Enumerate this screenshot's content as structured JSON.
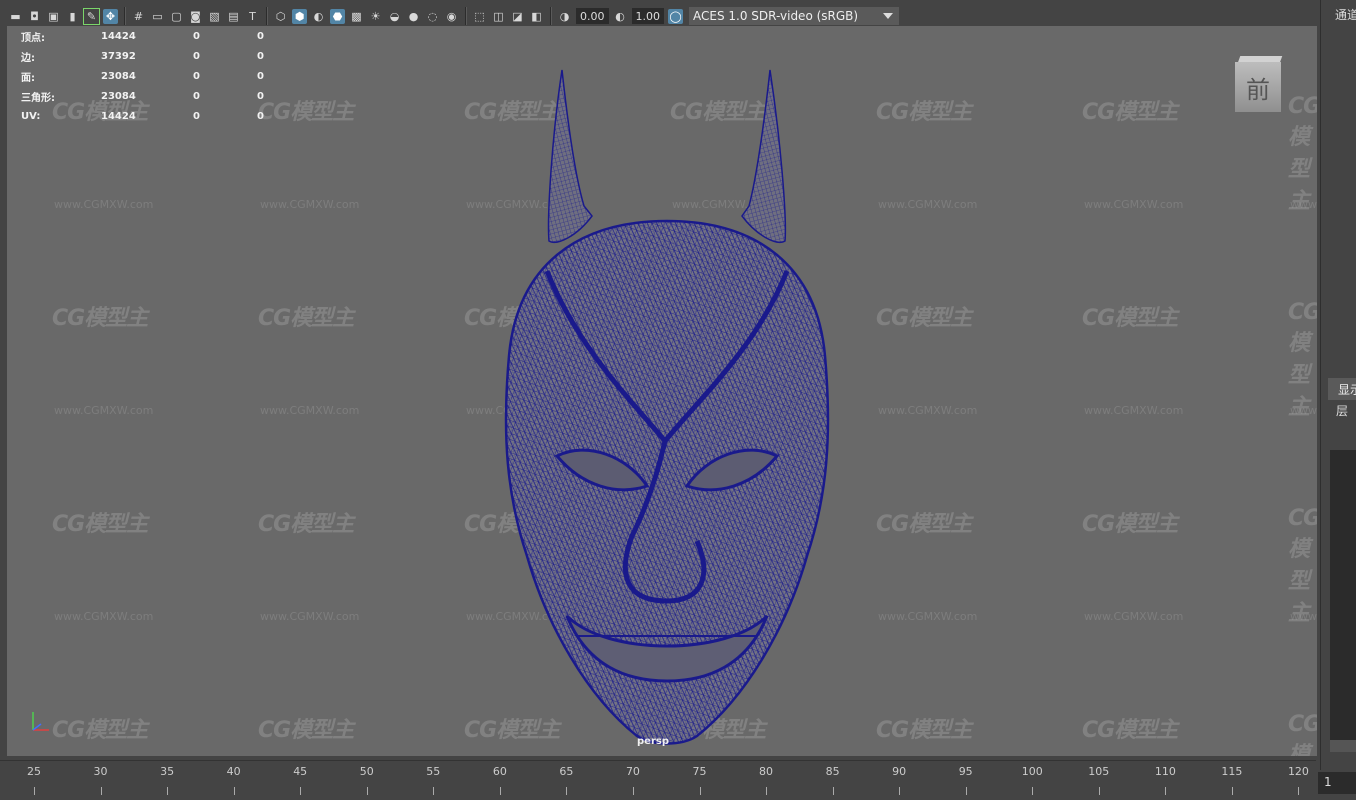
{
  "toolbar": {
    "gamma_value": "0.00",
    "exposure_value": "1.00",
    "color_management": "ACES 1.0 SDR-video (sRGB)",
    "icons": [
      "camera-select-icon",
      "camera-attributes-icon",
      "bookmarks-icon",
      "image-plane-icon",
      "grease-pencil-icon",
      "2d-pan-zoom-icon",
      "grid-icon",
      "film-gate-icon",
      "resolution-gate-icon",
      "gate-mask-icon",
      "field-chart-icon",
      "safe-action-icon",
      "safe-title-icon",
      "wireframe-icon",
      "smooth-shade-icon",
      "default-material-icon",
      "wireframe-on-shaded-icon",
      "textured-icon",
      "use-all-lights-icon",
      "shadows-icon",
      "screen-space-ao-icon",
      "motion-blur-icon",
      "anti-aliasing-icon",
      "isolate-select-icon",
      "xray-icon",
      "xray-joints-icon",
      "backface-culling-icon",
      "exposure-icon",
      "gamma-icon",
      "color-management-icon"
    ]
  },
  "hud": {
    "rows": [
      {
        "label": "顶点:",
        "total": "14424",
        "selected": "0",
        "extra": "0"
      },
      {
        "label": "边:",
        "total": "37392",
        "selected": "0",
        "extra": "0"
      },
      {
        "label": "面:",
        "total": "23084",
        "selected": "0",
        "extra": "0"
      },
      {
        "label": "三角形:",
        "total": "23084",
        "selected": "0",
        "extra": "0"
      },
      {
        "label": "UV:",
        "total": "14424",
        "selected": "0",
        "extra": "0"
      }
    ]
  },
  "viewport": {
    "view_cube_label": "前",
    "camera_label": "persp",
    "watermark_logo": "CG模型主",
    "watermark_url": "www.CGMXW.com",
    "mesh_color": "#1a1a8c",
    "background_color": "#696969"
  },
  "right_panel": {
    "channel_box_tab": "通道",
    "display_tab": "显示",
    "layer_label": "层"
  },
  "timeline": {
    "ticks": [
      "25",
      "30",
      "35",
      "40",
      "45",
      "50",
      "55",
      "60",
      "65",
      "70",
      "75",
      "80",
      "85",
      "90",
      "95",
      "100",
      "105",
      "110",
      "115",
      "120"
    ],
    "current_frame": "1"
  }
}
